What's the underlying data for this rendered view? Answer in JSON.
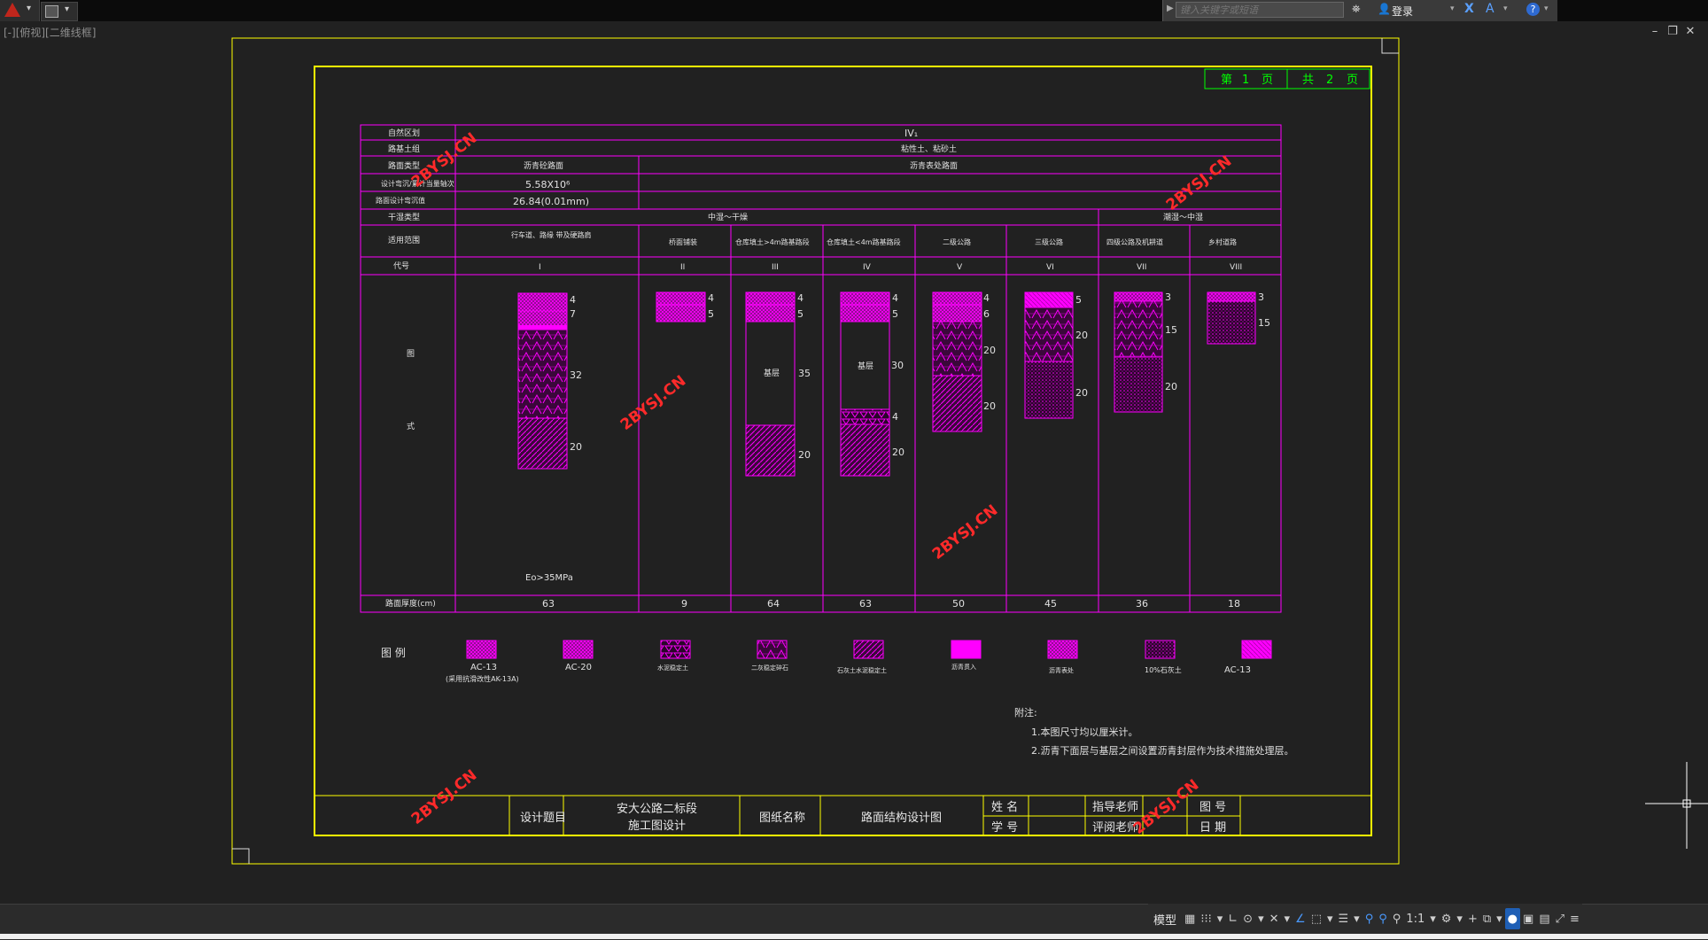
{
  "toolbar": {
    "search_placeholder": "键入关键字或短语",
    "login_label": "登录",
    "help_label": "?",
    "x_label": "X",
    "a_label": "A"
  },
  "viewport": {
    "label": "[-][俯视][二维线框]"
  },
  "window_controls": [
    "–",
    "❐",
    "✕"
  ],
  "drawing": {
    "page_info": {
      "page_prefix": "第",
      "page_num": "1",
      "page_suffix": "页",
      "total_prefix": "共",
      "total_num": "2",
      "total_suffix": "页"
    },
    "row_labels": [
      "自然区划",
      "路基土组",
      "路面类型",
      "设计弯沉/累计当量轴次",
      "路面设计弯沉值",
      "干湿类型",
      "适用范围",
      "代号",
      "图",
      "式",
      "路面厚度(cm)"
    ],
    "natural_zone": "IV₁",
    "soil_group": "粘性土、粘砂土",
    "pavement_type_1": "沥青砼路面",
    "pavement_type_2": "沥青表处路面",
    "traffic_value": "5.58X10⁶",
    "deflection_value": "26.84(0.01mm)",
    "dry_wet_1": "中湿～干燥",
    "dry_wet_2": "潮湿～中湿",
    "scope": [
      "行车道、路缘 带及硬路肩",
      "桥面铺装",
      "仓库填土>4m路基路段",
      "仓库填土<4m路基路段",
      "二级公路",
      "三级公路",
      "四级公路及机耕道",
      "乡村道路"
    ],
    "codes": [
      "I",
      "II",
      "III",
      "IV",
      "V",
      "VI",
      "VII",
      "VIII"
    ],
    "eo_label": "Eo>35MPa",
    "base_labels": [
      "基层",
      "基层"
    ],
    "thickness": {
      "c1": [
        "4",
        "7",
        "32",
        "20"
      ],
      "c2": [
        "4",
        "5"
      ],
      "c3": [
        "4",
        "5",
        "35",
        "20"
      ],
      "c4": [
        "4",
        "5",
        "30",
        "4",
        "20"
      ],
      "c5": [
        "4",
        "6",
        "20",
        "20"
      ],
      "c6": [
        "5",
        "20",
        "20"
      ],
      "c7": [
        "3",
        "15",
        "20"
      ],
      "c8": [
        "3",
        "15"
      ]
    },
    "totals": [
      "63",
      "9",
      "64",
      "63",
      "50",
      "45",
      "36",
      "18"
    ],
    "legend": {
      "title": "图 例",
      "items": [
        "AC-13",
        "AC-20",
        "水泥稳定土",
        "二灰稳定碎石",
        "石灰土水泥稳定土",
        "沥青贯入",
        "沥青表处",
        "10%石灰土",
        "AC-13"
      ],
      "item1_sub": "(采用抗滑改性AK-13A)"
    },
    "notes": {
      "title": "附注:",
      "lines": [
        "1.本图尺寸均以厘米计。",
        "2.沥青下面层与基层之间设置沥青封层作为技术措施处理层。"
      ]
    },
    "title_block": {
      "design_topic_label": "设计题目",
      "design_topic_value_1": "安大公路二标段",
      "design_topic_value_2": "施工图设计",
      "drawing_name_label": "图纸名称",
      "drawing_name_value": "路面结构设计图",
      "name_label": "姓 名",
      "student_id_label": "学 号",
      "advisor_label": "指导老师",
      "reviewer_label": "评阅老师",
      "drawing_no_label": "图 号",
      "date_label": "日 期"
    },
    "watermark": "2BYSJ.CN"
  },
  "statusbar": {
    "model_label": "模型",
    "scale_label": "1:1"
  },
  "colors": {
    "magenta": "#ff00ff",
    "yellow": "#ffff00",
    "green": "#00ff00",
    "red_watermark": "#ff2222",
    "background": "#212121"
  }
}
